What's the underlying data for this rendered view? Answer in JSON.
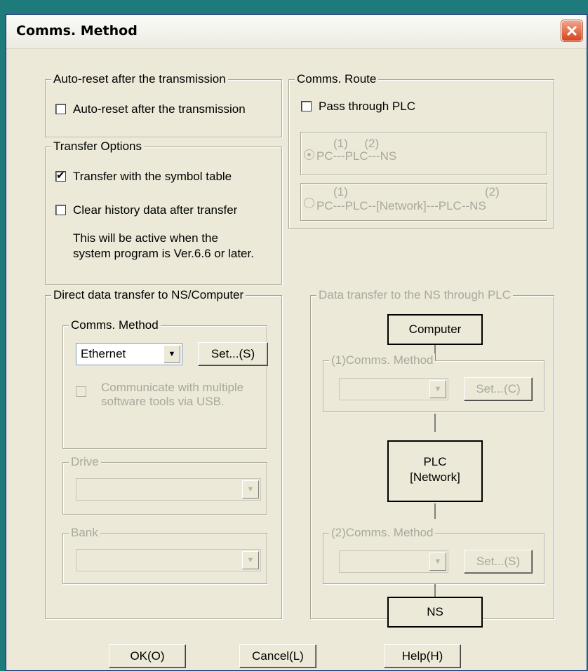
{
  "window": {
    "title": "Comms. Method",
    "close_symbol": "✕"
  },
  "auto_reset": {
    "legend": "Auto-reset after the transmission",
    "checkbox_label": "Auto-reset after the transmission",
    "checked": false
  },
  "transfer_options": {
    "legend": "Transfer Options",
    "symbol_table_label": "Transfer with the symbol table",
    "symbol_table_checked": true,
    "clear_history_label": "Clear history data after transfer",
    "clear_history_checked": false,
    "note_line1": "This will be active when the",
    "note_line2": "system program is Ver.6.6 or later."
  },
  "comms_route": {
    "legend": "Comms. Route",
    "pass_through_label": "Pass through PLC",
    "pass_through_checked": false,
    "route1_top": "(1)     (2)",
    "route1_bottom": "PC---PLC---NS",
    "route2_top_left": "(1)",
    "route2_top_right": "(2)",
    "route2_bottom": "PC---PLC--[Network]---PLC--NS"
  },
  "direct_transfer": {
    "legend": "Direct data transfer to NS/Computer",
    "comms_method": {
      "legend": "Comms. Method",
      "selected": "Ethernet",
      "set_button": "Set...(S)",
      "usb_line1": "Communicate with multiple",
      "usb_line2": "software tools via USB."
    },
    "drive": {
      "legend": "Drive",
      "selected": ""
    },
    "bank": {
      "legend": "Bank",
      "selected": ""
    }
  },
  "through_plc": {
    "legend": "Data transfer to the NS through PLC",
    "computer_label": "Computer",
    "method1_legend": "(1)Comms. Method",
    "method1_set": "Set...(C)",
    "plc_line1": "PLC",
    "plc_line2": "[Network]",
    "method2_legend": "(2)Comms. Method",
    "method2_set": "Set...(S)",
    "ns_label": "NS"
  },
  "footer": {
    "ok": "OK(O)",
    "cancel": "Cancel(L)",
    "help": "Help(H)"
  },
  "colors": {
    "dialog_bg": "#ece9d8",
    "title_close": "#d6441e",
    "disabled_text": "#a9a89d"
  }
}
